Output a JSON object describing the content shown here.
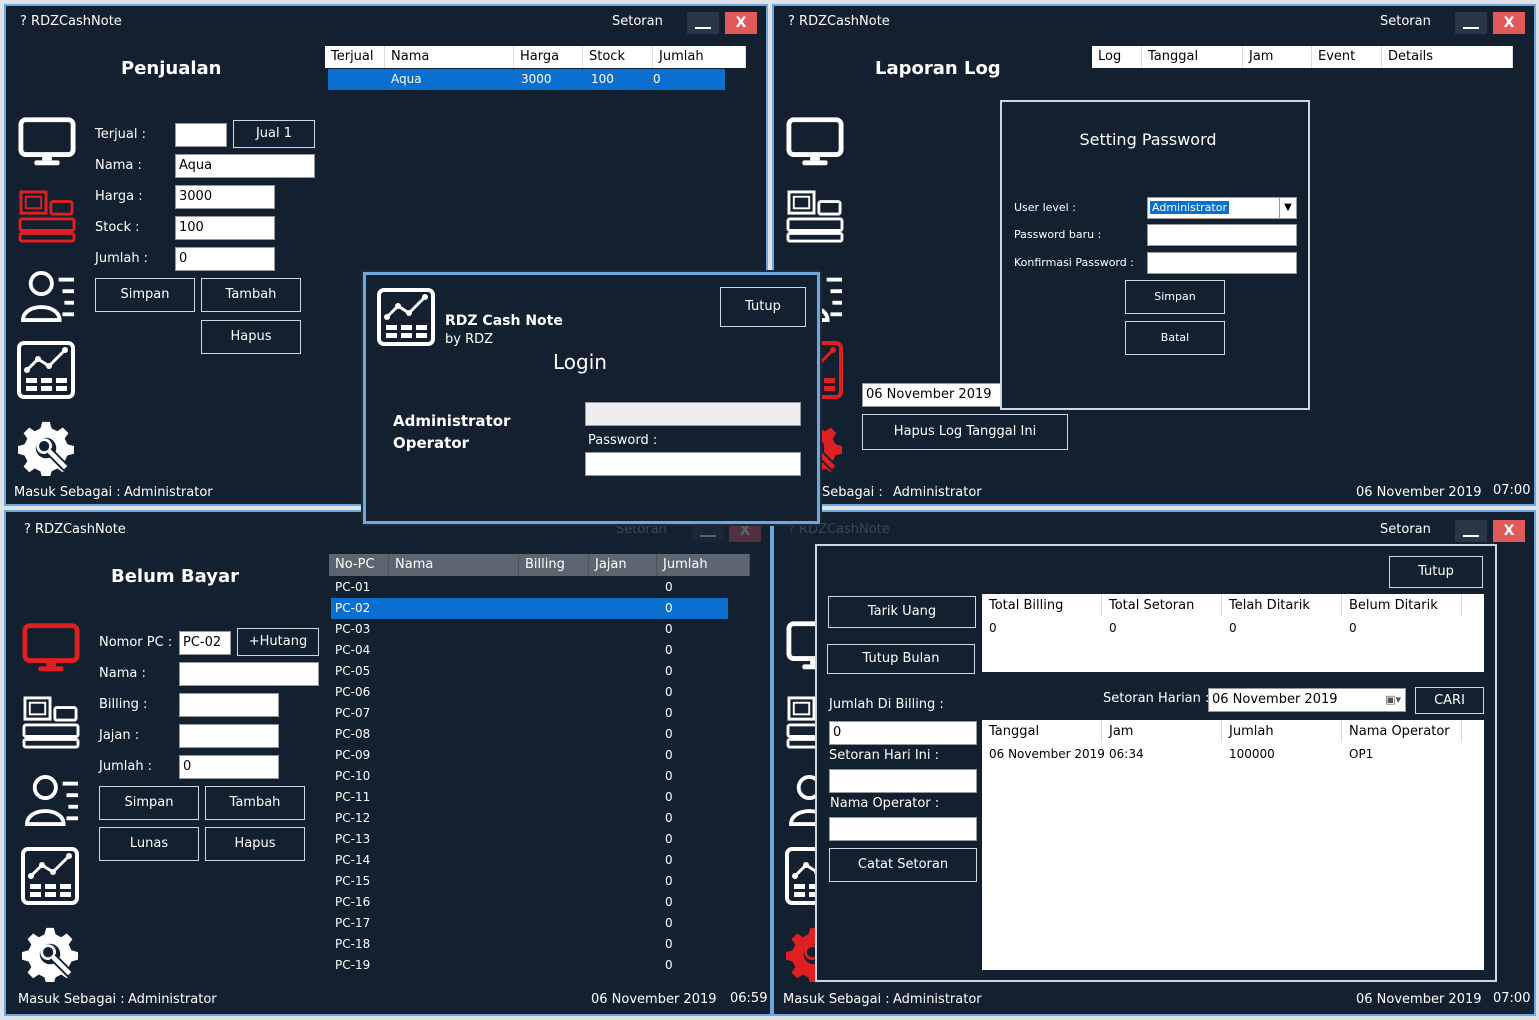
{
  "app_title": "? RDZCashNote",
  "setoran_link": "Setoran",
  "close_glyph": "X",
  "penjualan": {
    "heading": "Penjualan",
    "cols": [
      "Terjual",
      "Nama",
      "Harga",
      "Stock",
      "Jumlah"
    ],
    "row": [
      "",
      "Aqua",
      "3000",
      "100",
      "0"
    ],
    "labels": {
      "terjual": "Terjual :",
      "nama": "Nama :",
      "harga": "Harga :",
      "stock": "Stock :",
      "jumlah": "Jumlah :"
    },
    "values": {
      "terjual": "",
      "nama": "Aqua",
      "harga": "3000",
      "stock": "100",
      "jumlah": "0"
    },
    "jual_btn": "Jual 1",
    "simpan": "Simpan",
    "tambah": "Tambah",
    "hapus": "Hapus",
    "status_label": "Masuk Sebagai :",
    "status_user": "Administrator"
  },
  "laporan": {
    "heading": "Laporan Log",
    "cols": [
      "Log",
      "Tanggal",
      "Jam",
      "Event",
      "Details"
    ],
    "date_value": "06 November 2019",
    "hapus_btn": "Hapus Log Tanggal Ini",
    "status_label": "Sebagai :",
    "status_user": "Administrator",
    "status_date": "06 November 2019",
    "status_time": "07:00"
  },
  "setting": {
    "title": "Setting Password",
    "user_level_label": "User level :",
    "user_level_value": "Administrator",
    "password_baru_label": "Password baru :",
    "konfirmasi_label": "Konfirmasi Password :",
    "simpan": "Simpan",
    "batal": "Batal"
  },
  "login": {
    "brand": "RDZ Cash Note",
    "by": "by RDZ",
    "title": "Login",
    "tutup": "Tutup",
    "admin": "Administrator",
    "operator": "Operator",
    "password_label": "Password :"
  },
  "belum": {
    "heading": "Belum Bayar",
    "cols": [
      "No-PC",
      "Nama",
      "Billing",
      "Jajan",
      "Jumlah"
    ],
    "rows": [
      [
        "PC-01",
        "0"
      ],
      [
        "PC-02",
        "0"
      ],
      [
        "PC-03",
        "0"
      ],
      [
        "PC-04",
        "0"
      ],
      [
        "PC-05",
        "0"
      ],
      [
        "PC-06",
        "0"
      ],
      [
        "PC-07",
        "0"
      ],
      [
        "PC-08",
        "0"
      ],
      [
        "PC-09",
        "0"
      ],
      [
        "PC-10",
        "0"
      ],
      [
        "PC-11",
        "0"
      ],
      [
        "PC-12",
        "0"
      ],
      [
        "PC-13",
        "0"
      ],
      [
        "PC-14",
        "0"
      ],
      [
        "PC-15",
        "0"
      ],
      [
        "PC-16",
        "0"
      ],
      [
        "PC-17",
        "0"
      ],
      [
        "PC-18",
        "0"
      ],
      [
        "PC-19",
        "0"
      ]
    ],
    "selected_index": 1,
    "labels": {
      "nomor": "Nomor PC :",
      "nama": "Nama :",
      "billing": "Billing :",
      "jajan": "Jajan :",
      "jumlah": "Jumlah :"
    },
    "values": {
      "nomor": "PC-02",
      "nama": "",
      "billing": "",
      "jajan": "",
      "jumlah": "0"
    },
    "hutang_btn": "+Hutang",
    "simpan": "Simpan",
    "tambah": "Tambah",
    "lunas": "Lunas",
    "hapus": "Hapus",
    "status_label": "Masuk Sebagai :",
    "status_user": "Administrator",
    "status_date": "06 November 2019",
    "status_time": "06:59"
  },
  "setoran": {
    "tutup": "Tutup",
    "tarik_uang": "Tarik Uang",
    "tutup_bulan": "Tutup Bulan",
    "summary_cols": [
      "Total Billing",
      "Total Setoran",
      "Telah Ditarik",
      "Belum Ditarik"
    ],
    "summary_vals": [
      "0",
      "0",
      "0",
      "0"
    ],
    "jumlah_billing_label": "Jumlah Di Billing :",
    "jumlah_billing_value": "0",
    "harian_label": "Setoran Harian :",
    "harian_date": "06 November 2019",
    "cari": "CARI",
    "setoran_hari_label": "Setoran Hari Ini :",
    "nama_operator_label": "Nama Operator :",
    "catat": "Catat Setoran",
    "log_cols": [
      "Tanggal",
      "Jam",
      "Jumlah",
      "Nama Operator"
    ],
    "log_row": [
      "06 November 2019",
      "06:34",
      "100000",
      "OP1"
    ],
    "status_label": "Masuk Sebagai :",
    "status_user": "Administrator",
    "status_date": "06 November 2019",
    "status_time": "07:00"
  },
  "icons": {
    "monitor": "monitor-icon",
    "cashier": "cash-register-icon",
    "user": "user-list-icon",
    "chart": "chart-report-icon",
    "settings": "gear-wrench-icon"
  },
  "colors": {
    "bg": "#13202f",
    "accent": "#0a6fcf",
    "close": "#e05a5a",
    "active_icon": "#e02020"
  }
}
